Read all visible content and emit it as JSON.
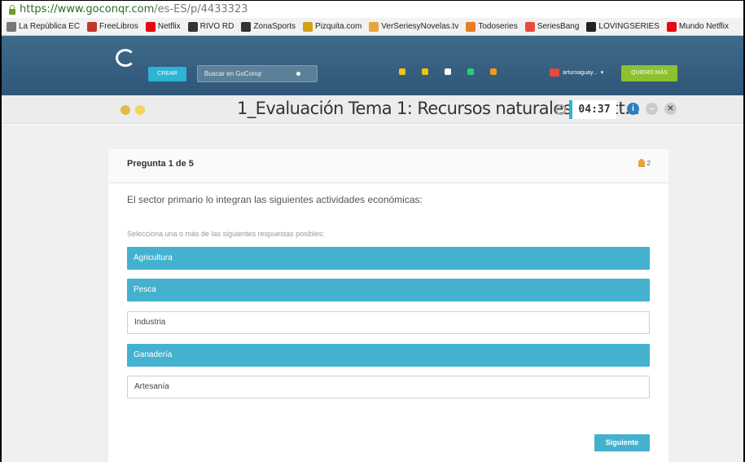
{
  "browser": {
    "url_host": "https://www.goconqr.com",
    "url_path": "/es-ES/p/4433323"
  },
  "bookmarks": [
    {
      "label": "La República EC",
      "icon": "news-icon",
      "color": "#777"
    },
    {
      "label": "FreeLibros",
      "icon": "book-icon",
      "color": "#c0392b"
    },
    {
      "label": "Netflix",
      "icon": "netflix-icon",
      "color": "#e50914"
    },
    {
      "label": "RIVO RD",
      "icon": "dots-icon",
      "color": "#333"
    },
    {
      "label": "ZonaSports",
      "icon": "ball-icon",
      "color": "#333"
    },
    {
      "label": "Pizquita.com",
      "icon": "pizquita-icon",
      "color": "#d4a017"
    },
    {
      "label": "VerSeriesyNovelas.tv",
      "icon": "tv-icon",
      "color": "#e8a33d"
    },
    {
      "label": "Todoseries",
      "icon": "todoseries-icon",
      "color": "#e67e22"
    },
    {
      "label": "SeriesBang",
      "icon": "seriesbang-icon",
      "color": "#e74c3c"
    },
    {
      "label": "LOVINGSERIES",
      "icon": "lovingseries-icon",
      "color": "#222"
    },
    {
      "label": "Mundo Netflix",
      "icon": "netflix-icon",
      "color": "#e50914"
    }
  ],
  "header": {
    "create_label": "CREAR",
    "search_placeholder": "Buscar en GoConqr",
    "username": "arturoaguay...",
    "cta_label": "QUIERO MÁS",
    "icon_colors": [
      "#f1c40f",
      "#f1c40f",
      "#ffffff",
      "#2ecc71",
      "#f39c12"
    ]
  },
  "quiz_bar": {
    "title": "1_Evaluación Tema 1: Recursos naturales y sect...",
    "timer": "04:37"
  },
  "question": {
    "counter": "Pregunta 1 de 5",
    "points": "2",
    "text": "El sector primario lo integran las siguientes actividades económicas:",
    "instruction": "Selecciona una o más de las siguientes respuestas posibles:",
    "options": [
      {
        "label": "Agricultura",
        "selected": true
      },
      {
        "label": "Pesca",
        "selected": true
      },
      {
        "label": "Industria",
        "selected": false
      },
      {
        "label": "Ganadería",
        "selected": true
      },
      {
        "label": "Artesanía",
        "selected": false
      }
    ],
    "next_label": "Siguiente"
  },
  "colors": {
    "accent": "#44b2cf",
    "header_bg": "#3f6a8a",
    "cta": "#8dc12e"
  }
}
